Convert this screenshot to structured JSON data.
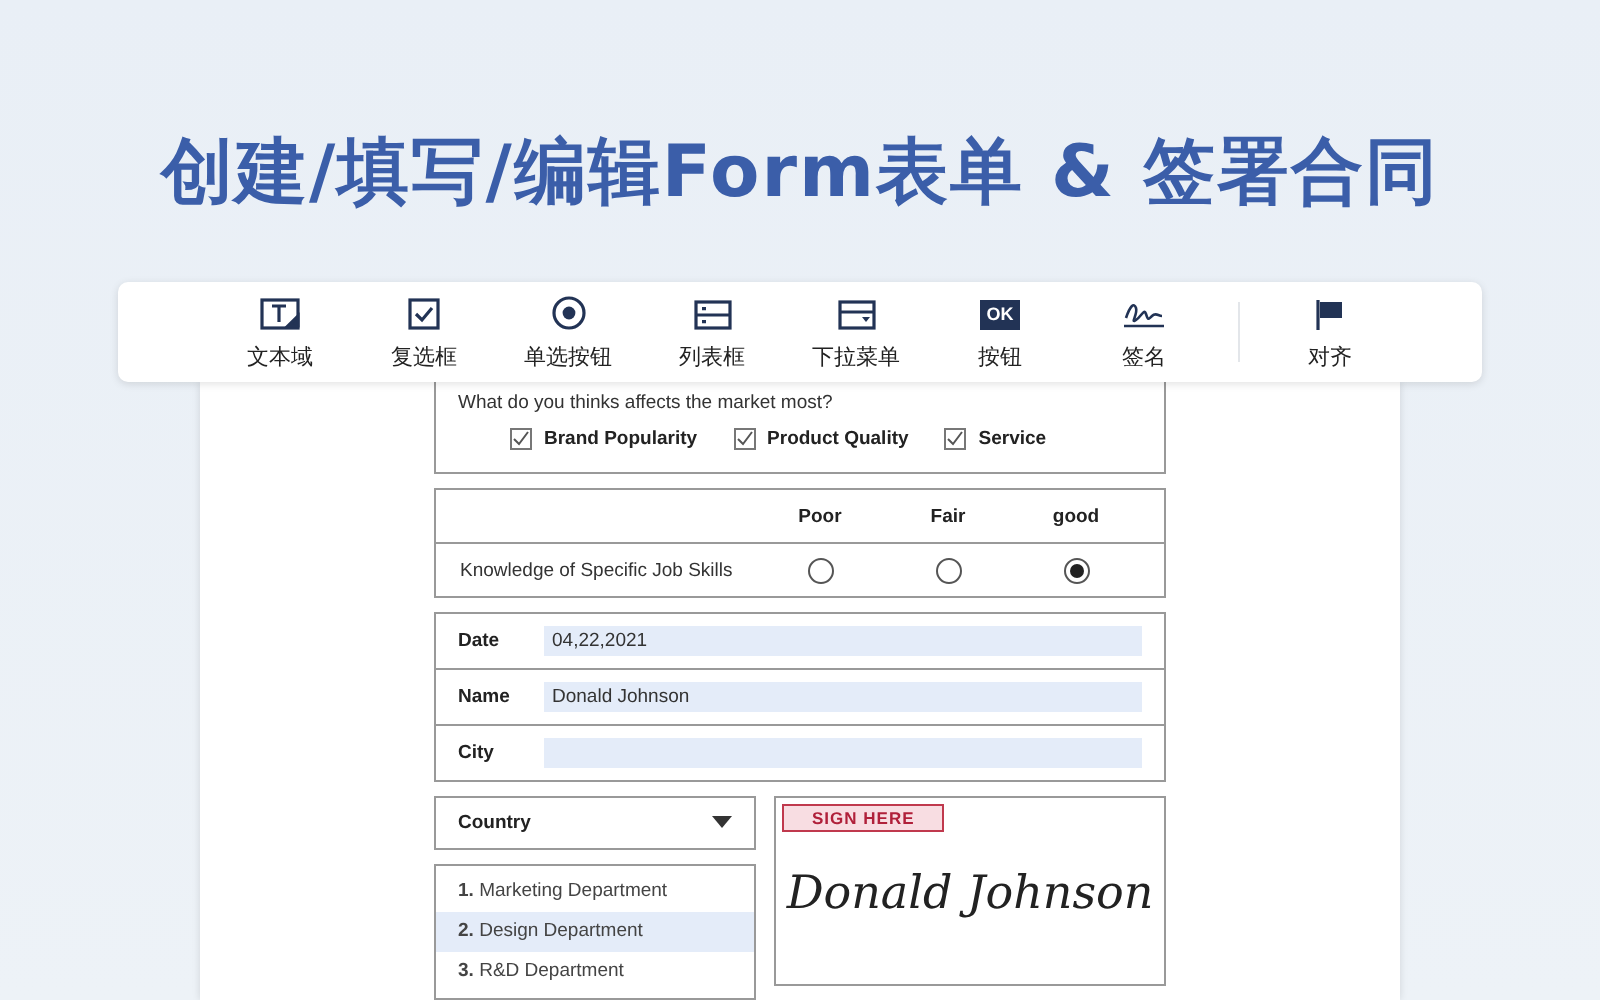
{
  "headline": "创建/填写/编辑Form表单 & 签署合同",
  "toolbar": [
    {
      "kind": "text",
      "label": "文本域"
    },
    {
      "kind": "checkbox",
      "label": "复选框"
    },
    {
      "kind": "radio",
      "label": "单选按钮"
    },
    {
      "kind": "list",
      "label": "列表框"
    },
    {
      "kind": "dropdown",
      "label": "下拉菜单"
    },
    {
      "kind": "button",
      "label": "按钮",
      "badge": "OK"
    },
    {
      "kind": "signature",
      "label": "签名"
    },
    {
      "kind": "align",
      "label": "对齐"
    }
  ],
  "question": {
    "text": "What do you thinks affects the market most?",
    "options": [
      {
        "label": "Brand Popularity",
        "checked": true
      },
      {
        "label": "Product Quality",
        "checked": true
      },
      {
        "label": "Service",
        "checked": true
      }
    ]
  },
  "rating": {
    "columns": [
      "Poor",
      "Fair",
      "good"
    ],
    "rows": [
      {
        "label": "Knowledge of Specific Job Skills",
        "choices": [
          {
            "selected": false
          },
          {
            "selected": false
          },
          {
            "selected": true
          }
        ]
      }
    ]
  },
  "fields": [
    {
      "label": "Date",
      "value": "04,22,2021"
    },
    {
      "label": "Name",
      "value": "Donald Johnson"
    },
    {
      "label": "City"
    }
  ],
  "dropdown": {
    "value": "Country"
  },
  "list": [
    {
      "text": "**1.** Marketing Department",
      "selected": false
    },
    {
      "text": "**2.** Design Department",
      "selected": true
    },
    {
      "text": "**3.** R&D Department",
      "selected": false
    }
  ],
  "signature": {
    "tag": "SIGN HERE",
    "name": "Donald Johnson"
  }
}
